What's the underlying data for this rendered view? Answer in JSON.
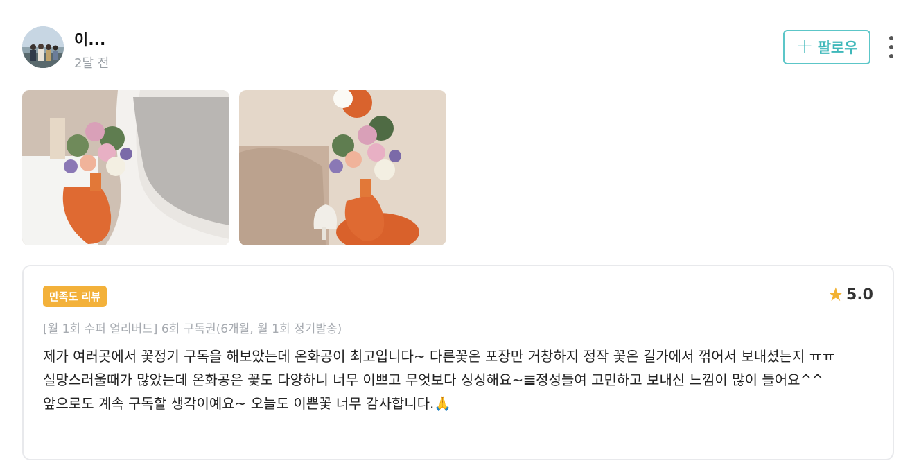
{
  "user": {
    "name": "이...",
    "posted_time": "2달 전"
  },
  "follow": {
    "plus_icon": "+",
    "label": "팔로우"
  },
  "photos": [
    {
      "alt": "꽃다발 사진 1"
    },
    {
      "alt": "꽃다발 사진 2"
    }
  ],
  "review": {
    "badge": "만족도 리뷰",
    "rating_icon": "★",
    "rating": "5.0",
    "product": "[월 1회 수퍼 얼리버드] 6회 구독권(6개월, 월 1회 정기발송)",
    "text": "제가 여러곳에서 꽃정기 구독을 해보았는데 온화공이 최고입니다~ 다른꽃은 포장만 거창하지 정작 꽃은 길가에서 꺾어서 보내셨는지 ㅠㅠ 실망스러울때가 많았는데 온화공은 꽃도 다양하니 너무 이쁘고 무엇보다 싱싱해요~𝌆정성들여 고민하고 보내신 느낌이 많이 들어요^^\n앞으로도 계속 구독할 생각이예요~ 오늘도 이쁜꽃 너무 감사합니다.🙏"
  },
  "colors": {
    "accent": "#3fb8ba",
    "badge": "#f3b13a",
    "star": "#f2b233",
    "muted": "#9aa0a6"
  }
}
